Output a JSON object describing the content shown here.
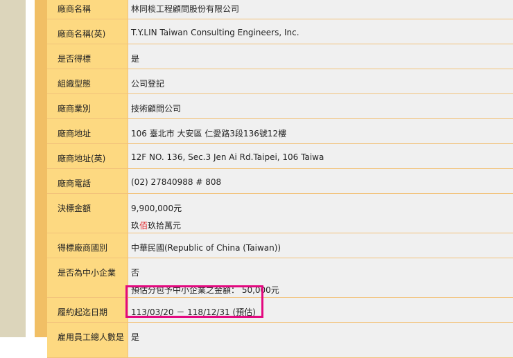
{
  "rows": [
    {
      "label": "廠商名稱",
      "value": "林同棪工程顧問股份有限公司"
    },
    {
      "label": "廠商名稱(英)",
      "value": "T.Y.LIN Taiwan Consulting Engineers, Inc."
    },
    {
      "label": "是否得標",
      "value": "是"
    },
    {
      "label": "組織型態",
      "value": "公司登記"
    },
    {
      "label": "廠商業別",
      "value": "技術顧問公司"
    },
    {
      "label": "廠商地址",
      "value": "106 臺北市 大安區 仁愛路3段136號12樓"
    },
    {
      "label": "廠商地址(英)",
      "value": "12F NO. 136, Sec.3 Jen Ai Rd.Taipei, 106 Taiwa"
    },
    {
      "label": "廠商電話",
      "value": "(02) 27840988 # 808"
    },
    {
      "label": "決標金額",
      "value": "9,900,000元",
      "chinese_a": "玖",
      "chinese_b": "佰",
      "chinese_c": "玖拾萬元"
    },
    {
      "label": "得標廠商國別",
      "value": "中華民國(Republic of China (Taiwan))"
    },
    {
      "label": "是否為中小企業",
      "value": "否",
      "value2": "預估分包予中小企業之金額： 50,000元"
    },
    {
      "label": "履約起迄日期",
      "value": "113/03/20 － 118/12/31 (預估)"
    },
    {
      "label": "雇用員工總人數是",
      "value": "是"
    }
  ],
  "colors": {
    "highlight": "#e3087f",
    "label_bg": "#fdd981",
    "value_bg": "#f0f0f0",
    "accent_red": "#e0262b"
  }
}
